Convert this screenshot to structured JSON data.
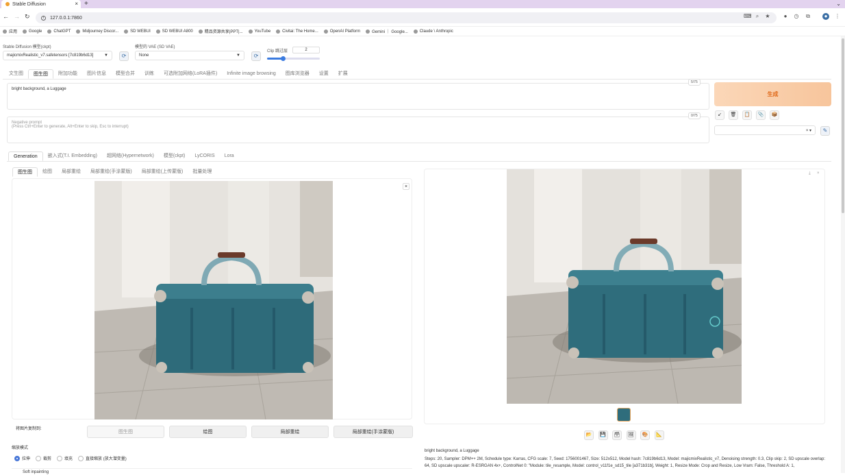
{
  "browser": {
    "tab_title": "Stable Diffusion",
    "url": "127.0.0.1:7860",
    "bookmarks": [
      "应用",
      "Google",
      "ChatGPT",
      "Midjourney Discor...",
      "SD WEBUI",
      "SD WEBUI A800",
      "精品资源共享|PPT|...",
      "YouTube",
      "Civitai: The Home...",
      "OpenAI Platform",
      "Gemini ｜ Google...",
      "Claude \\ Anthropic"
    ]
  },
  "settings": {
    "model_label": "Stable Diffusion 模型(ckpt)",
    "model_value": "majicmixRealistic_v7.safetensors [7c819b6d13]",
    "vae_label": "模型的 VAE (SD VAE)",
    "vae_value": "None",
    "clip_label": "Clip 跳过层",
    "clip_value": "2",
    "clip_slider_fraction": 0.3
  },
  "main_tabs": [
    "文生图",
    "图生图",
    "附加功能",
    "图片信息",
    "模型合并",
    "训练",
    "可选附加网络(LoRA插件)",
    "Infinite image browsing",
    "图库浏览器",
    "设置",
    "扩展"
  ],
  "prompt": {
    "value": "bright background, a Luggage",
    "counter": "5/75",
    "neg_label": "Negative prompt",
    "neg_placeholder": "(Press Ctrl+Enter to generate, Alt+Enter to skip, Esc to interrupt)",
    "neg_counter": "0/75"
  },
  "generate_label": "生成",
  "tool_icons": [
    "↙",
    "🗑",
    "📋",
    "📎",
    "📦"
  ],
  "gen_tabs": [
    "Generation",
    "嵌入式(T.I. Embedding)",
    "超网络(Hypernetwork)",
    "模型(ckpt)",
    "LyCORIS",
    "Lora"
  ],
  "img_tabs": [
    "图生图",
    "绘图",
    "局部重绘",
    "局部重绘(手涂蒙版)",
    "局部重绘(上传蒙版)",
    "批量处理"
  ],
  "copy_label": "将图片复制到:",
  "copy_buttons": [
    "图生图",
    "绘图",
    "局部重绘",
    "局部重绘(手涂蒙版)"
  ],
  "resize_label": "缩放模式",
  "resize_options": [
    "拉伸",
    "裁剪",
    "填充",
    "直接缩放 (放大潜变量)"
  ],
  "soft_inpainting": "Soft inpainting",
  "output": {
    "caption": "bright background, a Luggage",
    "params": "Steps: 20, Sampler: DPM++ 2M, Schedule type: Karras, CFG scale: 7, Seed: 1756001467, Size: 512x512, Model hash: 7c819b6d13, Model: majicmixRealistic_v7, Denoising strength: 0.3, Clip skip: 2, SD upscale overlap: 64, SD upscale upscaler: R-ESRGAN 4x+, ControlNet 0: \"Module: tile_resample, Model: control_v11f1e_sd15_tile [a371b31b], Weight: 1, Resize Mode: Crop and Resize, Low Vram: False, Threshold A: 1,"
  },
  "output_icons": [
    "📂",
    "💾",
    "🗃",
    "🖼",
    "🎨",
    "📐"
  ],
  "colors": {
    "accent": "#f7c59c",
    "generate_text": "#e06a1a",
    "tab_bar": "#e3d3ef",
    "luggage": "#2e6b7a"
  }
}
